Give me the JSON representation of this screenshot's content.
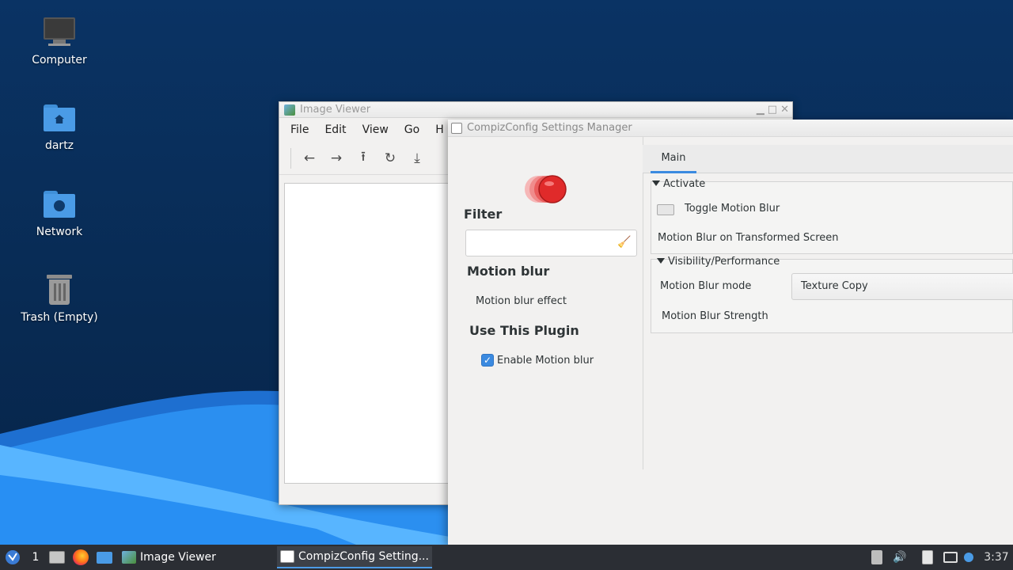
{
  "desktop": {
    "icons": [
      {
        "label": "Computer",
        "icon": "computer-icon"
      },
      {
        "label": "dartz",
        "icon": "home-folder-icon"
      },
      {
        "label": "Network",
        "icon": "network-folder-icon"
      },
      {
        "label": "Trash (Empty)",
        "icon": "trash-icon"
      }
    ]
  },
  "image_viewer": {
    "title": "Image Viewer",
    "menu": [
      "File",
      "Edit",
      "View",
      "Go",
      "H"
    ],
    "toolbar_icons": [
      "back-arrow-icon",
      "forward-arrow-icon",
      "upload-icon",
      "refresh-icon",
      "save-icon"
    ]
  },
  "ccsm": {
    "title": "CompizConfig Settings Manager",
    "filter_label": "Filter",
    "filter_value": "",
    "plugin_name": "Motion blur",
    "plugin_description": "Motion blur effect",
    "use_plugin_label": "Use This Plugin",
    "enable_label": "Enable Motion blur",
    "enable_checked": true,
    "tab_main": "Main",
    "sections": {
      "activate": {
        "title": "Activate",
        "toggle_label": "Toggle Motion Blur",
        "transformed_label": "Motion Blur on Transformed Screen"
      },
      "visibility": {
        "title": "Visibility/Performance",
        "mode_label": "Motion Blur mode",
        "mode_value": "Texture Copy",
        "strength_label": "Motion Blur Strength"
      }
    }
  },
  "taskbar": {
    "workspace": "1",
    "tasks": [
      {
        "label": "Image Viewer",
        "active": false
      },
      {
        "label": "CompizConfig Setting...",
        "active": true
      }
    ],
    "clock": "3:37"
  },
  "colors": {
    "accent": "#3b8ae0",
    "taskbar": "#2b2e34",
    "desktop": "#082a52"
  }
}
